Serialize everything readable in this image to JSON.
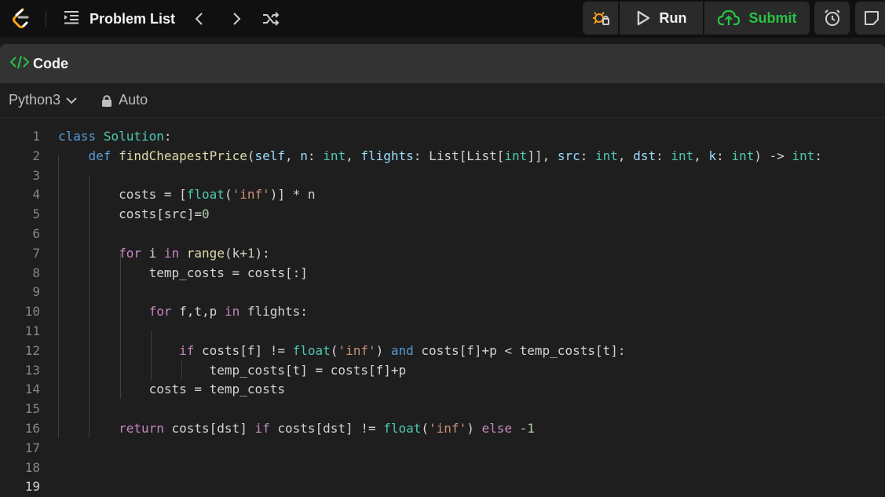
{
  "topbar": {
    "problem_list_label": "Problem List",
    "run_label": "Run",
    "submit_label": "Submit"
  },
  "panel": {
    "title": "Code"
  },
  "toolbar": {
    "language": "Python3",
    "mode": "Auto"
  },
  "editor": {
    "active_line": 19,
    "lines": [
      {
        "n": "1",
        "indent": 0,
        "tokens": [
          {
            "t": "class",
            "c": "kwb"
          },
          {
            "t": " "
          },
          {
            "t": "Solution",
            "c": "cls"
          },
          {
            "t": ":"
          }
        ]
      },
      {
        "n": "2",
        "indent": 1,
        "tokens": [
          {
            "t": "def",
            "c": "kwb"
          },
          {
            "t": " "
          },
          {
            "t": "findCheapestPrice",
            "c": "fn"
          },
          {
            "t": "("
          },
          {
            "t": "self",
            "c": "var"
          },
          {
            "t": ", "
          },
          {
            "t": "n",
            "c": "var"
          },
          {
            "t": ": "
          },
          {
            "t": "int",
            "c": "cls"
          },
          {
            "t": ", "
          },
          {
            "t": "flights",
            "c": "var"
          },
          {
            "t": ": "
          },
          {
            "t": "List",
            "c": "pl"
          },
          {
            "t": "["
          },
          {
            "t": "List",
            "c": "pl"
          },
          {
            "t": "["
          },
          {
            "t": "int",
            "c": "cls"
          },
          {
            "t": "]], "
          },
          {
            "t": "src",
            "c": "var"
          },
          {
            "t": ": "
          },
          {
            "t": "int",
            "c": "cls"
          },
          {
            "t": ", "
          },
          {
            "t": "dst",
            "c": "var"
          },
          {
            "t": ": "
          },
          {
            "t": "int",
            "c": "cls"
          },
          {
            "t": ", "
          },
          {
            "t": "k",
            "c": "var"
          },
          {
            "t": ": "
          },
          {
            "t": "int",
            "c": "cls"
          },
          {
            "t": ") -> "
          },
          {
            "t": "int",
            "c": "cls"
          },
          {
            "t": ":"
          }
        ]
      },
      {
        "n": "3",
        "indent": 0,
        "tokens": []
      },
      {
        "n": "4",
        "indent": 2,
        "tokens": [
          {
            "t": "costs = ["
          },
          {
            "t": "float",
            "c": "cls"
          },
          {
            "t": "("
          },
          {
            "t": "'inf'",
            "c": "str"
          },
          {
            "t": ")] * n"
          }
        ]
      },
      {
        "n": "5",
        "indent": 2,
        "tokens": [
          {
            "t": "costs[src]="
          },
          {
            "t": "0",
            "c": "num"
          }
        ]
      },
      {
        "n": "6",
        "indent": 0,
        "tokens": []
      },
      {
        "n": "7",
        "indent": 2,
        "tokens": [
          {
            "t": "for",
            "c": "kw"
          },
          {
            "t": " i "
          },
          {
            "t": "in",
            "c": "kw"
          },
          {
            "t": " "
          },
          {
            "t": "range",
            "c": "fn"
          },
          {
            "t": "(k+"
          },
          {
            "t": "1",
            "c": "num"
          },
          {
            "t": "):"
          }
        ]
      },
      {
        "n": "8",
        "indent": 3,
        "tokens": [
          {
            "t": "temp_costs = costs[:]"
          }
        ]
      },
      {
        "n": "9",
        "indent": 0,
        "tokens": []
      },
      {
        "n": "10",
        "indent": 3,
        "tokens": [
          {
            "t": "for",
            "c": "kw"
          },
          {
            "t": " f,t,p "
          },
          {
            "t": "in",
            "c": "kw"
          },
          {
            "t": " flights:"
          }
        ]
      },
      {
        "n": "11",
        "indent": 0,
        "tokens": []
      },
      {
        "n": "12",
        "indent": 4,
        "tokens": [
          {
            "t": "if",
            "c": "kw"
          },
          {
            "t": " costs[f] != "
          },
          {
            "t": "float",
            "c": "cls"
          },
          {
            "t": "("
          },
          {
            "t": "'inf'",
            "c": "str"
          },
          {
            "t": ") "
          },
          {
            "t": "and",
            "c": "kwb"
          },
          {
            "t": " costs[f]+p < temp_costs[t]:"
          }
        ]
      },
      {
        "n": "13",
        "indent": 5,
        "tokens": [
          {
            "t": "temp_costs[t] = costs[f]+p"
          }
        ]
      },
      {
        "n": "14",
        "indent": 3,
        "tokens": [
          {
            "t": "costs = temp_costs"
          }
        ]
      },
      {
        "n": "15",
        "indent": 0,
        "tokens": []
      },
      {
        "n": "16",
        "indent": 2,
        "tokens": [
          {
            "t": "return",
            "c": "kw"
          },
          {
            "t": " costs[dst] "
          },
          {
            "t": "if",
            "c": "kw"
          },
          {
            "t": " costs[dst] != "
          },
          {
            "t": "float",
            "c": "cls"
          },
          {
            "t": "("
          },
          {
            "t": "'inf'",
            "c": "str"
          },
          {
            "t": ") "
          },
          {
            "t": "else",
            "c": "kw"
          },
          {
            "t": " "
          },
          {
            "t": "-1",
            "c": "num"
          }
        ]
      },
      {
        "n": "17",
        "indent": 0,
        "tokens": []
      },
      {
        "n": "18",
        "indent": 0,
        "tokens": []
      },
      {
        "n": "19",
        "indent": 0,
        "tokens": []
      }
    ]
  }
}
